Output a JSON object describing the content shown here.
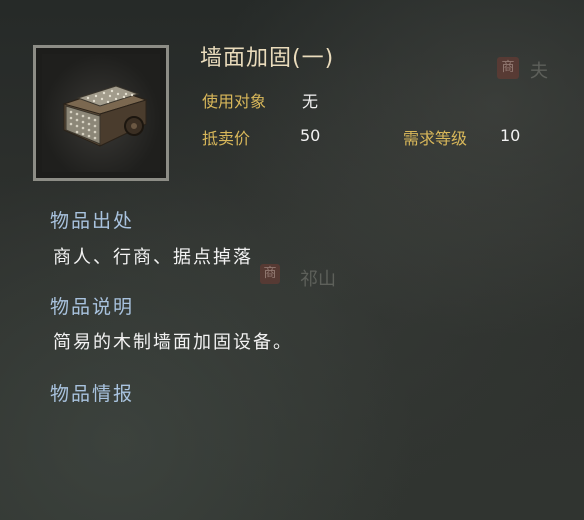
{
  "background": {
    "map_labels": [
      "祁山",
      "夫"
    ],
    "map_badges": [
      "商",
      "商"
    ]
  },
  "item": {
    "icon": "wooden-wall-reinforcement-icon",
    "name": "墙面加固(一)",
    "target_label": "使用对象",
    "target_value": "无",
    "price_label": "抵卖价",
    "price_value": "50",
    "level_label": "需求等级",
    "level_value": "10"
  },
  "sections": {
    "source_heading": "物品出处",
    "source_text": "商人、行商、据点掉落",
    "desc_heading": "物品说明",
    "desc_text": "简易的木制墙面加固设备。",
    "intel_heading": "物品情报"
  },
  "colors": {
    "label_gold": "#d8b75a",
    "heading_blue": "#a9c3df",
    "title_cream": "#eadcbc",
    "frame_gray": "#8d8d86"
  }
}
